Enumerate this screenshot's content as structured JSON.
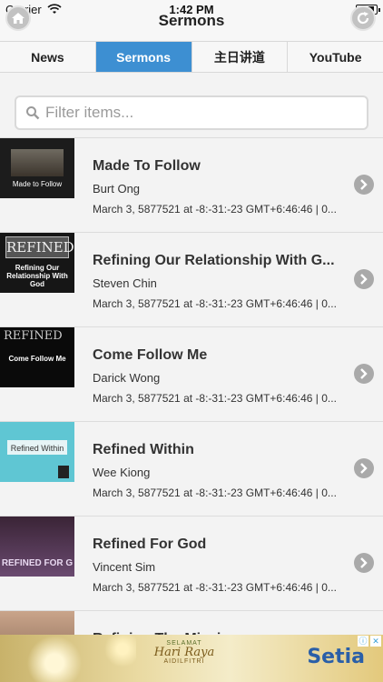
{
  "status_bar": {
    "carrier": "Carrier",
    "time": "1:42 PM",
    "battery_level": 0.9
  },
  "header": {
    "title": "Sermons"
  },
  "tabs": [
    {
      "label": "News",
      "active": false
    },
    {
      "label": "Sermons",
      "active": true
    },
    {
      "label": "主日讲道",
      "active": false
    },
    {
      "label": "YouTube",
      "active": false
    }
  ],
  "search": {
    "placeholder": "Filter items...",
    "value": ""
  },
  "sermons": [
    {
      "title": "Made To Follow",
      "speaker": "Burt Ong",
      "meta": "March 3, 5877521 at -8:-31:-23 GMT+6:46:46 | 0...",
      "thumb_caption": "Made to Follow"
    },
    {
      "title": "Refining Our Relationship With G...",
      "speaker": "Steven Chin",
      "meta": "March 3, 5877521 at -8:-31:-23 GMT+6:46:46 | 0...",
      "thumb_caption": "Refining Our Relationship With God"
    },
    {
      "title": "Come Follow Me",
      "speaker": "Darick Wong",
      "meta": "March 3, 5877521 at -8:-31:-23 GMT+6:46:46 | 0...",
      "thumb_caption": "Come Follow Me"
    },
    {
      "title": "Refined Within",
      "speaker": "Wee Kiong",
      "meta": "March 3, 5877521 at -8:-31:-23 GMT+6:46:46 | 0...",
      "thumb_caption": "Refined Within"
    },
    {
      "title": "Refined For God",
      "speaker": "Vincent Sim",
      "meta": "March 3, 5877521 at -8:-31:-23 GMT+6:46:46 | 0...",
      "thumb_caption": "REFINED FOR G"
    },
    {
      "title": "Refining The Mission",
      "speaker": "",
      "meta": "",
      "thumb_caption": ""
    }
  ],
  "ad": {
    "greeting_top": "SELAMAT",
    "greeting_main": "Hari Raya",
    "greeting_bottom": "AIDILFITRI",
    "brand": "Setia",
    "info_icon": "ⓘ",
    "close_icon": "✕"
  },
  "colors": {
    "accent": "#3d8fd2",
    "chevron": "#a9a9a9"
  }
}
